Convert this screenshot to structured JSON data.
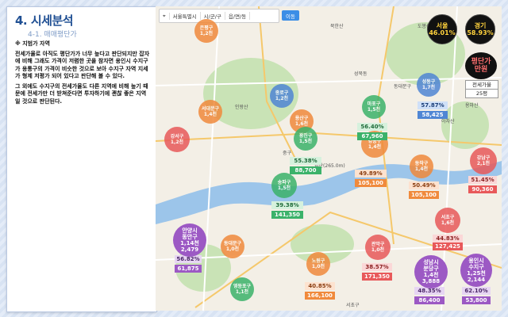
{
  "panel": {
    "title": "4. 시세분석",
    "subtitle": "4-1. 매매평단가",
    "paragraphs": [
      "※ 지범가 자역",
      "전세가율로 아직도 평단가가 너무 높다고 판단되지만 잡자에 비해 그래도 가격이 저렴한 곳을 참자면 용인시 수지구가 용통구의 가격이 비슷한 것으로 보아 수지구 자역 지세가 형제 저평가 되어 있다고 판단해 볼 수 있다.",
      "그 외에도 수지구의 전세가율도 다른 지역에 비해 높기 때문에 전세가만 더 받쳐준다면 투자하기에 괜찮 좋은 지역일 것으로 판단된다."
    ]
  },
  "search": {
    "city": "서울특별시",
    "district": "시/군/구",
    "dong": "읍/면/동",
    "go": "이동"
  },
  "badges": [
    {
      "name": "서울",
      "value": "46.01%"
    },
    {
      "name": "경기",
      "value": "58.93%"
    }
  ],
  "avg": {
    "line1": "평단가",
    "line2": "만원",
    "sub1": "전세가율",
    "sub2": "25평"
  },
  "places": [
    "인왕산",
    "중구",
    "동대문구",
    "아차산",
    "서초구",
    "북한산",
    "도봉산",
    "성북동",
    "남산(265.0m)",
    "용마산"
  ],
  "districts": [
    {
      "id": "d1",
      "line1": "은평구",
      "line2": "1,2천"
    },
    {
      "id": "d2",
      "line1": "서대문구",
      "line2": "1,4천"
    },
    {
      "id": "d3",
      "line1": "종로구",
      "line2": "1,2천"
    },
    {
      "id": "d4",
      "line1": "강서구",
      "line2": "1,2천"
    },
    {
      "id": "d5",
      "line1": "용산구",
      "line2": "1,6천"
    },
    {
      "id": "d6",
      "line1": "마포구",
      "line2": "1,5천"
    },
    {
      "id": "d7",
      "line1": "성동구",
      "line2": "1,7천"
    },
    {
      "id": "d8",
      "line1": "광진구",
      "line2": "1,5천"
    },
    {
      "id": "d9",
      "line1": "강동구",
      "line2": "1,4천"
    },
    {
      "id": "d10",
      "line1": "동작구",
      "line2": "1,4천"
    },
    {
      "id": "d11",
      "line1": "강남구",
      "line2": "2,1천"
    },
    {
      "id": "d12",
      "line1": "송파구",
      "line2": "1,5천"
    },
    {
      "id": "d13",
      "line1": "서초구",
      "line2": "1,6천"
    },
    {
      "id": "d14",
      "line1": "관악구",
      "line2": "1,0천"
    },
    {
      "id": "d15",
      "line1": "노원구",
      "line2": "1,0천"
    },
    {
      "id": "d16",
      "line1": "동대문구",
      "line2": "1,0천"
    },
    {
      "id": "d17",
      "line1": "영등포구",
      "line2": "1,1천"
    }
  ],
  "pcts": [
    {
      "id": "p1",
      "value": "57.87%"
    },
    {
      "id": "p2",
      "value": "58,425"
    },
    {
      "id": "p3",
      "value": "56.40%"
    },
    {
      "id": "p4",
      "value": "67,960"
    },
    {
      "id": "p5",
      "value": "55.38%"
    },
    {
      "id": "p6",
      "value": "88,700"
    },
    {
      "id": "p7",
      "value": "49.89%"
    },
    {
      "id": "p8",
      "value": "105,100"
    },
    {
      "id": "p9",
      "value": "50.49%"
    },
    {
      "id": "p10",
      "value": "105,100"
    },
    {
      "id": "p11",
      "value": "51.45%"
    },
    {
      "id": "p12",
      "value": "90,360"
    },
    {
      "id": "p13",
      "value": "39.38%"
    },
    {
      "id": "p14",
      "value": "141,350"
    },
    {
      "id": "p15",
      "value": "44.83%"
    },
    {
      "id": "p16",
      "value": "127,425"
    },
    {
      "id": "p17",
      "value": "38.57%"
    },
    {
      "id": "p18",
      "value": "171,350"
    },
    {
      "id": "p19",
      "value": "40.85%"
    },
    {
      "id": "p20",
      "value": "166,100"
    },
    {
      "id": "p21",
      "value": "56.82%"
    },
    {
      "id": "p22",
      "value": "61,875"
    },
    {
      "id": "p23",
      "value": "48.35%"
    },
    {
      "id": "p24",
      "value": "86,400"
    },
    {
      "id": "p25",
      "value": "62.10%"
    },
    {
      "id": "p26",
      "value": "53,800"
    }
  ],
  "specials": [
    {
      "id": "s1",
      "line1": "안양시",
      "line2": "동안구",
      "line3": "1,14천",
      "line4": "2,479"
    },
    {
      "id": "s2",
      "line1": "성남시",
      "line2": "분당구",
      "line3": "1,4천",
      "line4": "3,888"
    },
    {
      "id": "s3",
      "line1": "용인시",
      "line2": "수지구",
      "line3": "1,25천",
      "line4": "2,144"
    }
  ],
  "colors": {
    "red": "#e8595a",
    "orange": "#f08a3c",
    "green": "#3bb26a",
    "blue": "#4f86d4",
    "purple": "#9c59c4",
    "river": "#9cc5ea",
    "park": "#c9e3b6"
  }
}
